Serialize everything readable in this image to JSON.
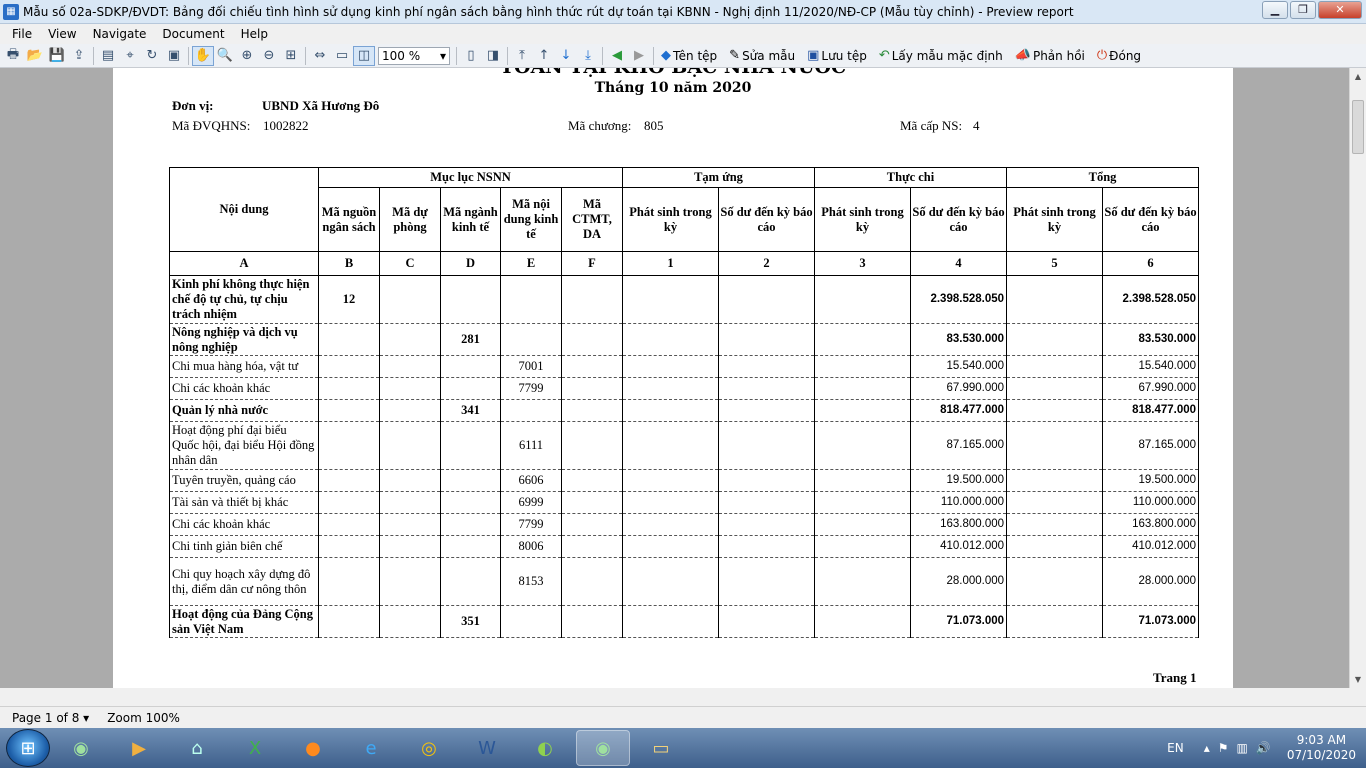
{
  "window": {
    "title": "Mẫu số 02a-SDKP/ĐVDT: Bảng đối chiếu tình hình sử dụng kinh phí ngân sách bằng hình thức rút dự toán tại KBNN - Nghị định 11/2020/NĐ-CP (Mẫu tùy chỉnh) - Preview report"
  },
  "menu": [
    "File",
    "View",
    "Navigate",
    "Document",
    "Help"
  ],
  "toolbar": {
    "zoom": "100 %",
    "ten_tep": "Tên tệp",
    "sua_mau": "Sửa mẫu",
    "luu_tep": "Lưu tệp",
    "lay_mau": "Lấy mẫu mặc định",
    "phan_hoi": "Phản hồi",
    "dong": "Đóng"
  },
  "report": {
    "title": "TOÁN TẠI KHO BẠC NHÀ NƯỚC",
    "period": "Tháng 10 năm 2020",
    "don_vi_label": "Đơn vị:",
    "don_vi": "UBND Xã Hương Đô",
    "ma_dvqhns_label": "Mã ĐVQHNS:",
    "ma_dvqhns": "1002822",
    "ma_chuong_label": "Mã chương:",
    "ma_chuong": "805",
    "ma_cap_label": "Mã cấp NS:",
    "ma_cap": "4",
    "headers": {
      "noi_dung": "Nội dung",
      "muc_luc": "Mục lục NSNN",
      "tam_ung": "Tạm ứng",
      "thuc_chi": "Thực chi",
      "tong": "Tổng",
      "ma_nguon": "Mã nguồn ngân sách",
      "ma_du_phong": "Mã dự phòng",
      "ma_nganh": "Mã ngành kinh tế",
      "ma_noi_dung": "Mã nội dung kinh tế",
      "ma_ctmt": "Mã CTMT, DA",
      "phat_sinh": "Phát sinh trong kỳ",
      "so_du": "Số dư đến kỳ báo cáo"
    },
    "letters": [
      "A",
      "B",
      "C",
      "D",
      "E",
      "F",
      "1",
      "2",
      "3",
      "4",
      "5",
      "6"
    ],
    "rows": [
      {
        "bold": true,
        "noi_dung": "Kinh phí không thực hiện chế độ tự chủ, tự chịu trách nhiệm",
        "ma_nguon": "12",
        "ma_nganh": "",
        "ma_nd": "",
        "thuc_chi_so_du": "2.398.528.050",
        "tong_so_du": "2.398.528.050"
      },
      {
        "bold": true,
        "noi_dung": "Nông nghiệp và dịch vụ nông nghiệp",
        "ma_nguon": "",
        "ma_nganh": "281",
        "ma_nd": "",
        "thuc_chi_so_du": "83.530.000",
        "tong_so_du": "83.530.000"
      },
      {
        "bold": false,
        "noi_dung": "Chi mua hàng hóa, vật tư",
        "ma_nguon": "",
        "ma_nganh": "",
        "ma_nd": "7001",
        "thuc_chi_so_du": "15.540.000",
        "tong_so_du": "15.540.000"
      },
      {
        "bold": false,
        "noi_dung": "Chi các khoản khác",
        "ma_nguon": "",
        "ma_nganh": "",
        "ma_nd": "7799",
        "thuc_chi_so_du": "67.990.000",
        "tong_so_du": "67.990.000"
      },
      {
        "bold": true,
        "noi_dung": "Quản lý nhà nước",
        "ma_nguon": "",
        "ma_nganh": "341",
        "ma_nd": "",
        "thuc_chi_so_du": "818.477.000",
        "tong_so_du": "818.477.000"
      },
      {
        "bold": false,
        "noi_dung": "Hoạt động phí đại biểu Quốc hội, đại biểu Hội đồng nhân dân",
        "ma_nguon": "",
        "ma_nganh": "",
        "ma_nd": "6111",
        "thuc_chi_so_du": "87.165.000",
        "tong_so_du": "87.165.000"
      },
      {
        "bold": false,
        "noi_dung": "Tuyên truyền, quảng cáo",
        "ma_nguon": "",
        "ma_nganh": "",
        "ma_nd": "6606",
        "thuc_chi_so_du": "19.500.000",
        "tong_so_du": "19.500.000"
      },
      {
        "bold": false,
        "noi_dung": "Tài sản và thiết bị khác",
        "ma_nguon": "",
        "ma_nganh": "",
        "ma_nd": "6999",
        "thuc_chi_so_du": "110.000.000",
        "tong_so_du": "110.000.000"
      },
      {
        "bold": false,
        "noi_dung": "Chi các khoản khác",
        "ma_nguon": "",
        "ma_nganh": "",
        "ma_nd": "7799",
        "thuc_chi_so_du": "163.800.000",
        "tong_so_du": "163.800.000"
      },
      {
        "bold": false,
        "noi_dung": "Chi tinh giản biên chế",
        "ma_nguon": "",
        "ma_nganh": "",
        "ma_nd": "8006",
        "thuc_chi_so_du": "410.012.000",
        "tong_so_du": "410.012.000"
      },
      {
        "bold": false,
        "noi_dung": "Chi quy hoạch xây dựng đô thị, điểm dân cư nông thôn",
        "ma_nguon": "",
        "ma_nganh": "",
        "ma_nd": "8153",
        "thuc_chi_so_du": "28.000.000",
        "tong_so_du": "28.000.000"
      },
      {
        "bold": true,
        "noi_dung": "Hoạt động của Đảng Cộng sản Việt Nam",
        "ma_nguon": "",
        "ma_nganh": "351",
        "ma_nd": "",
        "thuc_chi_so_du": "71.073.000",
        "tong_so_du": "71.073.000"
      }
    ],
    "page_label": "Trang 1"
  },
  "status": {
    "page": "Page 1 of 8",
    "zoom": "Zoom 100%"
  },
  "tray": {
    "lang": "EN",
    "time": "9:03 AM",
    "date": "07/10/2020"
  }
}
